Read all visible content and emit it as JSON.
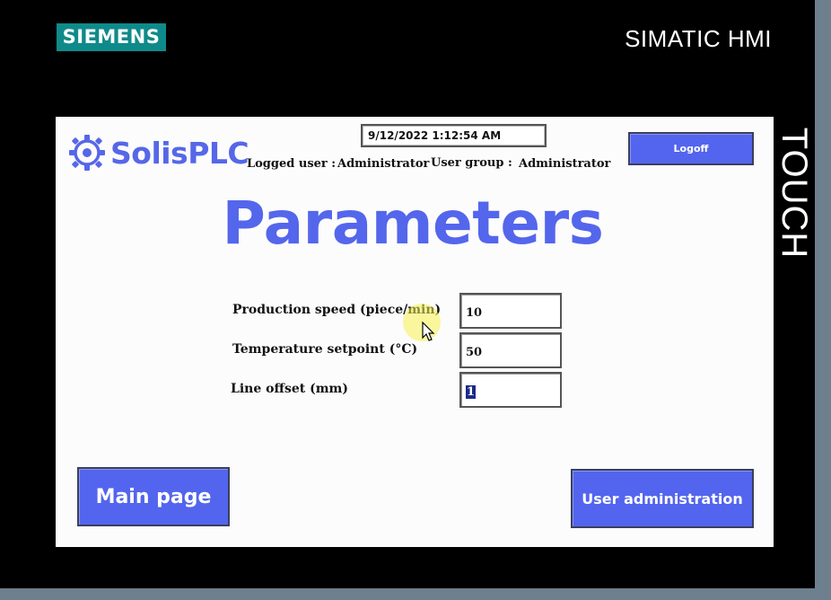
{
  "device": {
    "brand": "SIEMENS",
    "model": "SIMATIC HMI",
    "side_label": "TOUCH"
  },
  "header": {
    "logo_text": "SolisPLC",
    "datetime": "9/12/2022 1:12:54 AM",
    "logged_user_label": "Logged user :",
    "logged_user_value": "Administrator",
    "user_group_label": "User group :",
    "user_group_value": "Administrator",
    "logoff_label": "Logoff"
  },
  "page": {
    "title": "Parameters"
  },
  "parameters": [
    {
      "label": "Production speed (piece/min)",
      "value": "10"
    },
    {
      "label": "Temperature setpoint (°C)",
      "value": "50"
    },
    {
      "label": "Line offset (mm)",
      "value": "1"
    }
  ],
  "nav": {
    "main_page_label": "Main page",
    "user_admin_label": "User administration"
  },
  "colors": {
    "accent": "#5365ee",
    "siemens_teal": "#0f8a8a",
    "bezel": "#000000"
  }
}
